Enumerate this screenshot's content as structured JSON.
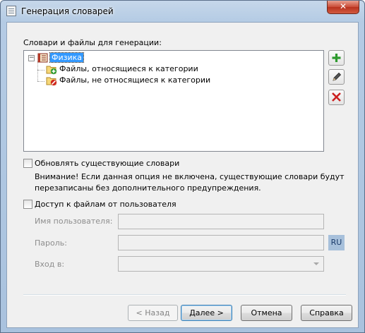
{
  "window": {
    "title": "Генерация словарей",
    "close_glyph": "✕"
  },
  "dictionaries": {
    "section_label": "Словари и файлы для генерации:",
    "tree": {
      "expander_glyph": "−",
      "root": {
        "label": "Физика",
        "icon": "dictionary-book-icon",
        "selected": true
      },
      "children": [
        {
          "label": "Файлы, относящиеся к категории",
          "icon": "folder-include-icon"
        },
        {
          "label": "Файлы, не относящиеся к категории",
          "icon": "folder-exclude-icon"
        }
      ]
    },
    "side_buttons": [
      {
        "name": "add",
        "icon": "plus-icon",
        "color": "#2e9a2e"
      },
      {
        "name": "edit",
        "icon": "pencil-icon",
        "color": "#404040"
      },
      {
        "name": "delete",
        "icon": "x-icon",
        "color": "#cc2020"
      }
    ]
  },
  "update_option": {
    "label": "Обновлять существующие словари",
    "checked": false,
    "warning_line1": "Внимание! Если данная опция не включена, существующие словари будут",
    "warning_line2": "перезаписаны без дополнительного предупреждения."
  },
  "user_access": {
    "label": "Доступ к файлам от пользователя",
    "checked": false,
    "username_label": "Имя пользователя:",
    "username_value": "",
    "password_label": "Пароль:",
    "password_value": "",
    "language_indicator": "RU",
    "login_label": "Вход в:",
    "login_value": ""
  },
  "footer": {
    "back_label": "< Назад",
    "next_label": "Далее >",
    "cancel_label": "Отмена",
    "help_label": "Справка"
  }
}
